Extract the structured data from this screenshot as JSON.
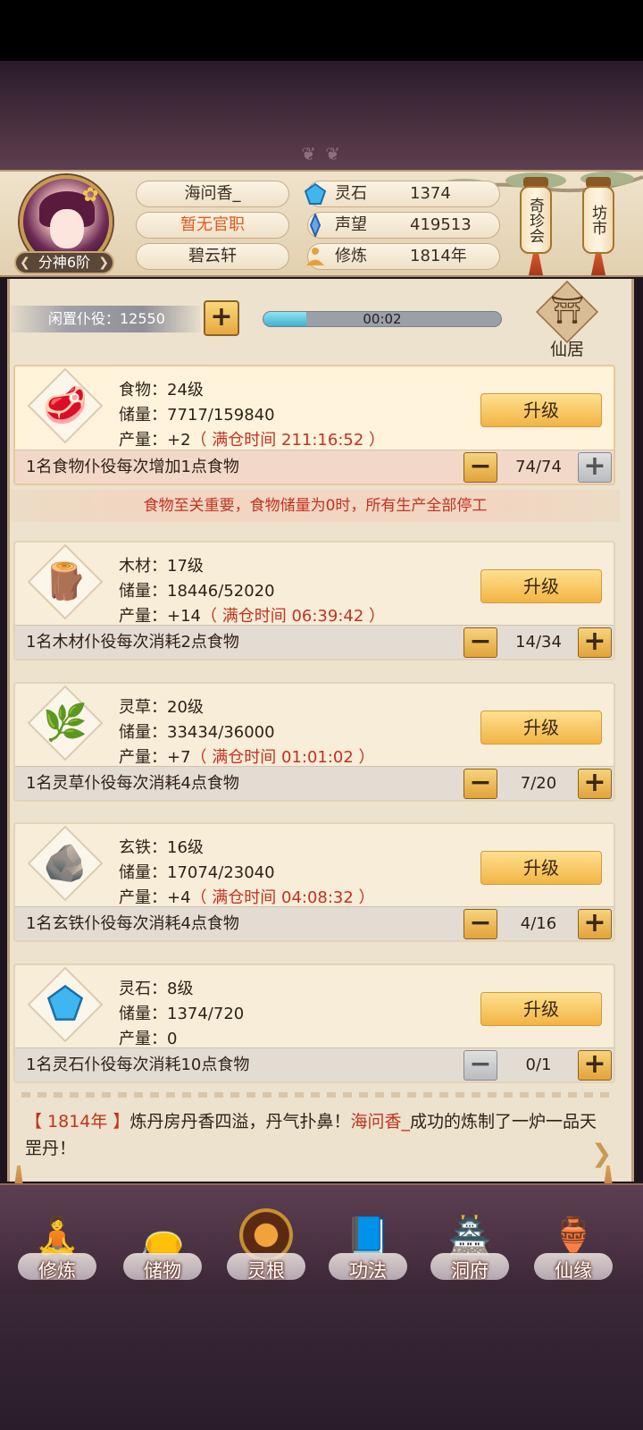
{
  "player": {
    "name": "海问香_",
    "title": "暂无官职",
    "sect": "碧云轩",
    "rank": "分神6阶"
  },
  "resources": [
    {
      "label": "灵石",
      "value": "1374",
      "icon": "spirit-stone-icon"
    },
    {
      "label": "声望",
      "value": "419513",
      "icon": "reputation-icon"
    },
    {
      "label": "修炼",
      "value": "1814年",
      "icon": "meditation-icon"
    }
  ],
  "lanterns": {
    "treasure": "奇珍会",
    "market": "坊市"
  },
  "idle": {
    "label": "闲置仆役：12550",
    "plus": "+",
    "timer": "00:02",
    "progress": 0.18
  },
  "xianju": {
    "label": "仙居"
  },
  "cards": [
    {
      "name": "食物：24级",
      "storage": "储量：7717/159840",
      "output": "产量：+2",
      "full": "（ 满仓时间 211:16:52 ）",
      "upgrade": "升级",
      "desc": "1名食物仆役每次增加1点食物",
      "count": "74/74",
      "minus": "−",
      "plus": "+",
      "icon": "meat-icon"
    },
    {
      "name": "木材：17级",
      "storage": "储量：18446/52020",
      "output": "产量：+14",
      "full": "（ 满仓时间 06:39:42 ）",
      "upgrade": "升级",
      "desc": "1名木材仆役每次消耗2点食物",
      "count": "14/34",
      "minus": "−",
      "plus": "+",
      "icon": "wood-icon"
    },
    {
      "name": "灵草：20级",
      "storage": "储量：33434/36000",
      "output": "产量：+7",
      "full": "（ 满仓时间 01:01:02 ）",
      "upgrade": "升级",
      "desc": "1名灵草仆役每次消耗4点食物",
      "count": "7/20",
      "minus": "−",
      "plus": "+",
      "icon": "herb-icon"
    },
    {
      "name": "玄铁：16级",
      "storage": "储量：17074/23040",
      "output": "产量：+4",
      "full": "（ 满仓时间 04:08:32 ）",
      "upgrade": "升级",
      "desc": "1名玄铁仆役每次消耗4点食物",
      "count": "4/16",
      "minus": "−",
      "plus": "+",
      "icon": "iron-ore-icon"
    },
    {
      "name": "灵石：8级",
      "storage": "储量：1374/720",
      "output": "产量：0",
      "full": "",
      "upgrade": "升级",
      "desc": "1名灵石仆役每次消耗10点食物",
      "count": "0/1",
      "minus": "−",
      "plus": "+",
      "icon": "spirit-stone-icon"
    }
  ],
  "warning": "食物至关重要，食物储量为0时，所有生产全部停工",
  "log": {
    "year": "【 1814年 】",
    "text1": "炼丹房丹香四溢，丹气扑鼻！",
    "name": "海问香_",
    "text2": "成功的炼制了一炉一品天罡丹！"
  },
  "nav": [
    {
      "label": "修炼",
      "icon": "meditation-figure-icon"
    },
    {
      "label": "储物",
      "icon": "treasure-bag-icon"
    },
    {
      "label": "灵根",
      "icon": "spirit-root-icon"
    },
    {
      "label": "功法",
      "icon": "scroll-book-icon"
    },
    {
      "label": "洞府",
      "icon": "palace-icon"
    },
    {
      "label": "仙缘",
      "icon": "gourd-icon"
    }
  ]
}
